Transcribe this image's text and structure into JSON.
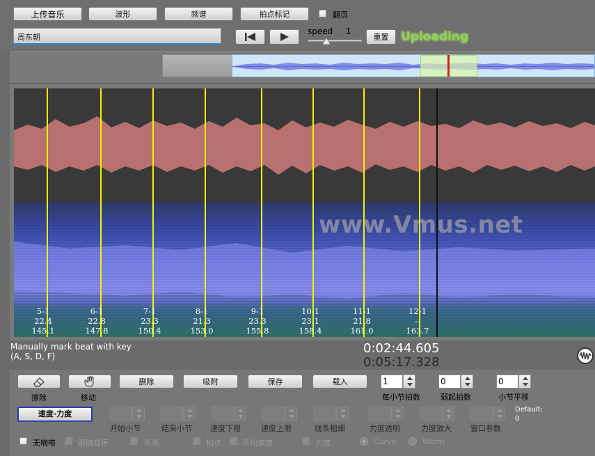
{
  "toolbar": {
    "upload_label": "上传音乐",
    "waveform_label": "波形",
    "spectrum_label": "频谱",
    "beat_mark_label": "拍点标记",
    "page_turn_label": "翻页"
  },
  "song": {
    "title": "周东朝"
  },
  "playback": {
    "speed_label": "speed",
    "speed_value": "1",
    "reset_label": "重置",
    "status": "Uploading"
  },
  "view": {
    "watermark": "www.Vmus.net"
  },
  "beats": [
    {
      "bar": "5-1",
      "speed": "22.4",
      "time": "145.1"
    },
    {
      "bar": "6-1",
      "speed": "22.8",
      "time": "147.8"
    },
    {
      "bar": "7-1",
      "speed": "23.3",
      "time": "150.4"
    },
    {
      "bar": "8-1",
      "speed": "21.3",
      "time": "153.0"
    },
    {
      "bar": "9-1",
      "speed": "23.3",
      "time": "155.8"
    },
    {
      "bar": "10-1",
      "speed": "23.1",
      "time": "158.4"
    },
    {
      "bar": "11-1",
      "speed": "21.8",
      "time": "161.0"
    },
    {
      "bar": "12-1",
      "speed": "--",
      "time": "163.7"
    }
  ],
  "info": {
    "hint_line1": "Manually mark beat with key",
    "hint_line2": "(A, S, D, F)",
    "current_time": "0:02:44.605",
    "total_time": "0:05:17.328"
  },
  "actions": {
    "erase_label": "擦除",
    "move_label": "移动",
    "delete_label": "删除",
    "snap_label": "吸附",
    "save_label": "保存",
    "load_label": "载入"
  },
  "spinners": {
    "beats_per_bar": {
      "value": "1",
      "label": "每小节拍数"
    },
    "pickup_beats": {
      "value": "0",
      "label": "弱起拍数"
    },
    "bar_shift": {
      "value": "0",
      "label": "小节平移"
    }
  },
  "params": {
    "speed_force_label": "速度-力度",
    "start_bar": "开始小节",
    "end_bar": "结束小节",
    "speed_lower": "速度下限",
    "speed_upper": "速度上限",
    "line_thickness": "线条粗细",
    "force_transparency": "力度透明",
    "force_zoom": "力度放大",
    "window_params": "窗口参数",
    "default_label": "Default:",
    "default_value": "0"
  },
  "options": {
    "no_click": "无嘀嗒",
    "follow_music": "跟随音乐",
    "smooth": "平滑",
    "beat_point": "拍点",
    "avg_speed": "平均速度",
    "force": "力度",
    "curve": "Curve",
    "worm": "Worm"
  },
  "colors": {
    "accent_green": "#8fd14f",
    "beat_line": "#f2f200",
    "waveform": "#b87070",
    "spectrogram": "#6f6fd6",
    "playhead": "#cc2222"
  }
}
